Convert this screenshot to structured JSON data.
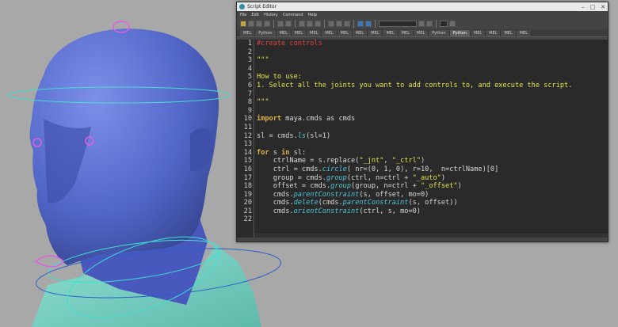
{
  "window": {
    "title": "Script Editor",
    "minimize": "–",
    "maximize": "□",
    "close": "✕"
  },
  "menu": [
    "File",
    "Edit",
    "History",
    "Command",
    "Help"
  ],
  "tabs": [
    {
      "label": "MEL",
      "active": false
    },
    {
      "label": "Python",
      "active": false
    },
    {
      "label": "MEL",
      "active": false
    },
    {
      "label": "MEL",
      "active": false
    },
    {
      "label": "MEL",
      "active": false
    },
    {
      "label": "MEL",
      "active": false
    },
    {
      "label": "MEL",
      "active": false
    },
    {
      "label": "MEL",
      "active": false
    },
    {
      "label": "MEL",
      "active": false
    },
    {
      "label": "MEL",
      "active": false
    },
    {
      "label": "MEL",
      "active": false
    },
    {
      "label": "MEL",
      "active": false
    },
    {
      "label": "Python",
      "active": false
    },
    {
      "label": "Python",
      "active": true
    },
    {
      "label": "MEL",
      "active": false
    },
    {
      "label": "MEL",
      "active": false
    },
    {
      "label": "MEL",
      "active": false
    },
    {
      "label": "MEL",
      "active": false
    }
  ],
  "code_lines": [
    [
      {
        "t": "#create controls",
        "c": "cm"
      }
    ],
    [],
    [
      {
        "t": "\"\"\"",
        "c": "doc"
      }
    ],
    [],
    [
      {
        "t": "How to use:",
        "c": "doc"
      }
    ],
    [
      {
        "t": "1. Select all the joints you want to add controls to, and execute the script.",
        "c": "doc"
      }
    ],
    [],
    [
      {
        "t": "\"\"\"",
        "c": "doc"
      }
    ],
    [],
    [
      {
        "t": "import",
        "c": "kw"
      },
      {
        "t": " maya.cmds as cmds",
        "c": ""
      }
    ],
    [],
    [
      {
        "t": "sl = cmds.",
        "c": ""
      },
      {
        "t": "ls",
        "c": "fn"
      },
      {
        "t": "(sl=1)",
        "c": ""
      }
    ],
    [],
    [
      {
        "t": "for",
        "c": "kw"
      },
      {
        "t": " s ",
        "c": ""
      },
      {
        "t": "in",
        "c": "kw"
      },
      {
        "t": " sl:",
        "c": ""
      }
    ],
    [
      {
        "t": "    ctrlName = s.replace(",
        "c": ""
      },
      {
        "t": "\"_jnt\"",
        "c": "st"
      },
      {
        "t": ", ",
        "c": ""
      },
      {
        "t": "\"_ctrl\"",
        "c": "st"
      },
      {
        "t": ")",
        "c": ""
      }
    ],
    [
      {
        "t": "    ctrl = cmds.",
        "c": ""
      },
      {
        "t": "circle",
        "c": "fn"
      },
      {
        "t": "( nr=(0, 1, 0), r=10,  n=ctrlName)[0]",
        "c": ""
      }
    ],
    [
      {
        "t": "    group = cmds.",
        "c": ""
      },
      {
        "t": "group",
        "c": "fn"
      },
      {
        "t": "(ctrl, n=ctrl + ",
        "c": ""
      },
      {
        "t": "\"_auto\"",
        "c": "st"
      },
      {
        "t": ")",
        "c": ""
      }
    ],
    [
      {
        "t": "    offset = cmds.",
        "c": ""
      },
      {
        "t": "group",
        "c": "fn"
      },
      {
        "t": "(group, n=ctrl + ",
        "c": ""
      },
      {
        "t": "\"_offset\"",
        "c": "st"
      },
      {
        "t": ")",
        "c": ""
      }
    ],
    [
      {
        "t": "    cmds.",
        "c": ""
      },
      {
        "t": "parentConstraint",
        "c": "fn"
      },
      {
        "t": "(s, offset, mo=0)",
        "c": ""
      }
    ],
    [
      {
        "t": "    cmds.",
        "c": ""
      },
      {
        "t": "delete",
        "c": "fn"
      },
      {
        "t": "(cmds.",
        "c": ""
      },
      {
        "t": "parentConstraint",
        "c": "fn"
      },
      {
        "t": "(s, offset))",
        "c": ""
      }
    ],
    [
      {
        "t": "    cmds.",
        "c": ""
      },
      {
        "t": "orientConstraint",
        "c": "fn"
      },
      {
        "t": "(ctrl, s, mo=0)",
        "c": ""
      }
    ],
    []
  ],
  "colors": {
    "viewport_bg": "#a8a8a8",
    "head": "#5a6fd0",
    "shirt": "#7fd6c8",
    "control_curve": "#40e0d0",
    "selection": "#e060e0"
  }
}
